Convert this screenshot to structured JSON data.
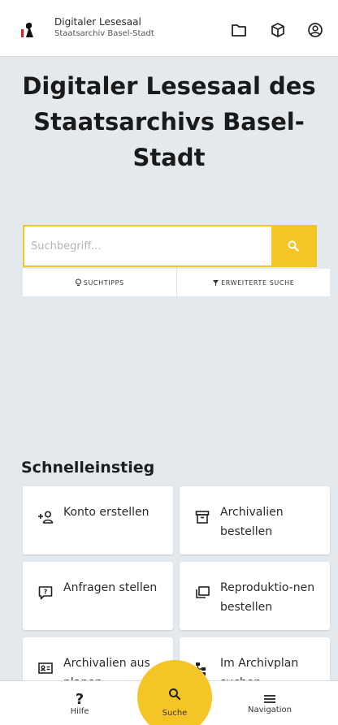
{
  "header": {
    "title": "Digitaler Lesesaal",
    "subtitle": "Staatsarchiv Basel-Stadt",
    "icons": [
      "folder-icon",
      "box-icon",
      "account-icon"
    ]
  },
  "main": {
    "title": "Digitaler Lesesaal des Staatsarchivs Basel-Stadt"
  },
  "search": {
    "placeholder": "Suchbegriff...",
    "tips_label": "SUCHTIPPS",
    "advanced_label": "ERWEITERTE SUCHE"
  },
  "quick": {
    "title": "Schnelleinstieg",
    "cards": [
      {
        "label": "Konto erstellen",
        "icon": "add-user-icon"
      },
      {
        "label": "Archivalien bestellen",
        "icon": "archive-box-icon"
      },
      {
        "label": "Anfragen stellen",
        "icon": "question-chat-icon"
      },
      {
        "label": "Reproduktio-nen bestellen",
        "icon": "copies-icon"
      },
      {
        "label": "Archivalien aus planen",
        "icon": "id-card-icon"
      },
      {
        "label": "Im Archivplan suchen",
        "icon": "hierarchy-icon"
      }
    ]
  },
  "nav": {
    "help": "Hilfe",
    "search": "Suche",
    "navigation": "Navigation"
  },
  "colors": {
    "accent": "#f5c426",
    "background": "#e4e9ee"
  }
}
